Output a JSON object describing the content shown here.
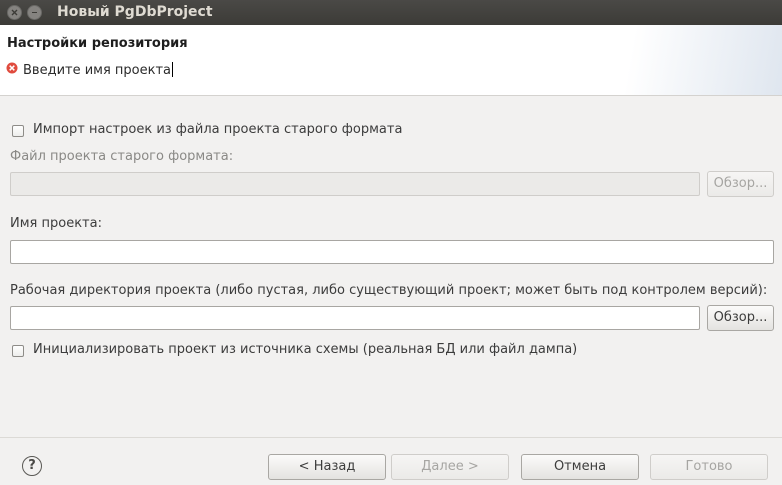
{
  "window": {
    "title": "Новый PgDbProject"
  },
  "header": {
    "title": "Настройки репозитория",
    "error_message": "Введите имя проекта"
  },
  "form": {
    "import_checkbox": {
      "label": "Импорт настроек из файла проекта старого формата",
      "checked": false
    },
    "old_file": {
      "label": "Файл проекта старого формата:",
      "value": "",
      "browse_label": "Обзор..."
    },
    "project_name": {
      "label": "Имя проекта:",
      "value": ""
    },
    "workdir": {
      "label": "Рабочая директория проекта (либо пустая, либо существующий проект; может быть под контролем версий):",
      "value": "",
      "browse_label": "Обзор..."
    },
    "init_checkbox": {
      "label": "Инициализировать проект из источника схемы (реальная БД или файл дампа)",
      "checked": false
    }
  },
  "footer": {
    "help_symbol": "?",
    "back_label": "< Назад",
    "next_label": "Далее >",
    "cancel_label": "Отмена",
    "finish_label": "Готово"
  },
  "colors": {
    "error": "#e04b3e",
    "titlebar": "#3c3b37",
    "window_bg": "#f2f1f0"
  }
}
